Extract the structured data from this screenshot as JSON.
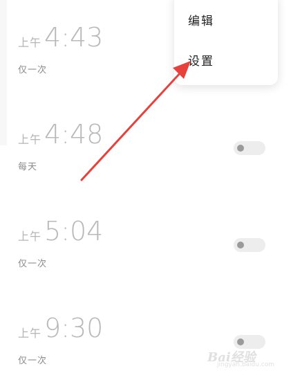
{
  "alarms": [
    {
      "ampm": "上午",
      "time": "4:43",
      "repeat": "仅一次",
      "enabled": false
    },
    {
      "ampm": "上午",
      "time": "4:48",
      "repeat": "每天",
      "enabled": false
    },
    {
      "ampm": "上午",
      "time": "5:04",
      "repeat": "仅一次",
      "enabled": false
    },
    {
      "ampm": "上午",
      "time": "9:30",
      "repeat": "仅一次",
      "enabled": false
    }
  ],
  "menu": {
    "items": [
      {
        "label": "编辑"
      },
      {
        "label": "设置"
      }
    ]
  },
  "colors": {
    "arrow": "#e8413c",
    "time_text": "#b8b8b8",
    "toggle_track": "#ededed",
    "toggle_knob": "#9a9a9a"
  },
  "watermark": {
    "text": "Bai经验",
    "sub": "jingyan.baidu.com"
  }
}
